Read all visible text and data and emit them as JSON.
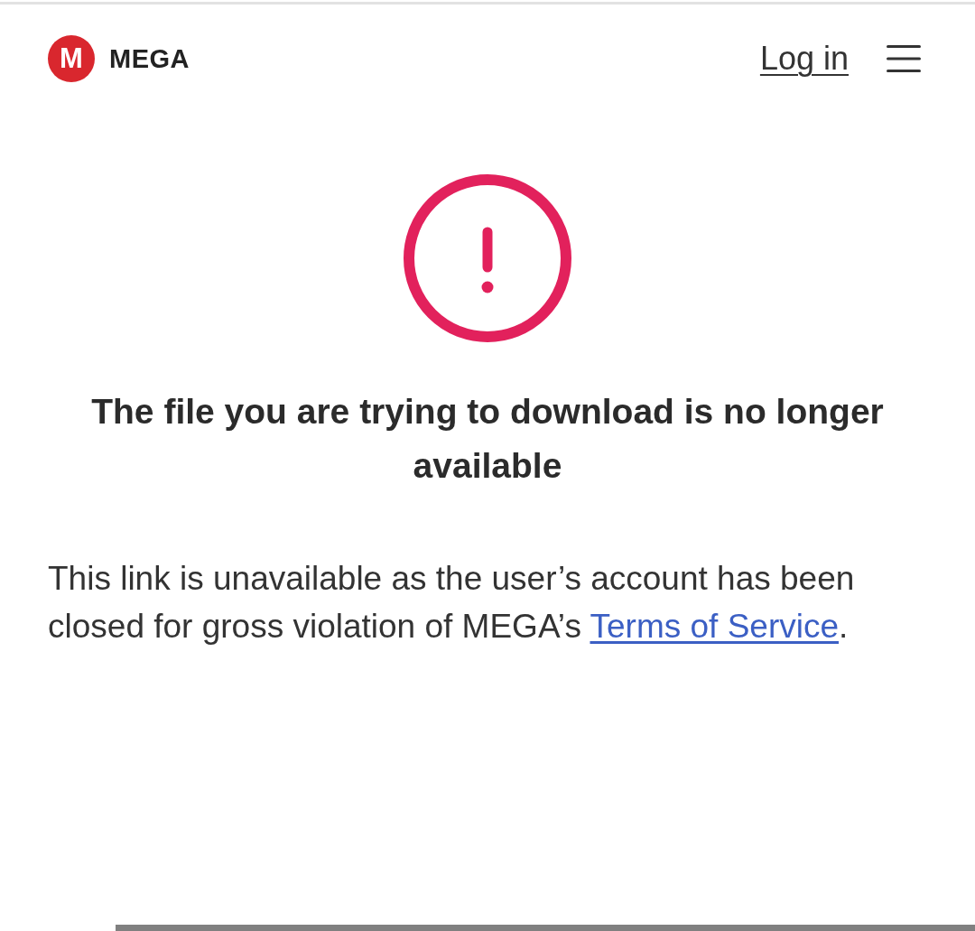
{
  "header": {
    "logo": {
      "mark": "M",
      "name": "MEGA"
    },
    "login_link": "Log in"
  },
  "message": {
    "title": "The file you are trying to download is no longer available",
    "body": "This link is unavailable as the user’s account has been closed for gross violation of MEGA’s ",
    "link": "Terms of Service",
    "after": "."
  }
}
